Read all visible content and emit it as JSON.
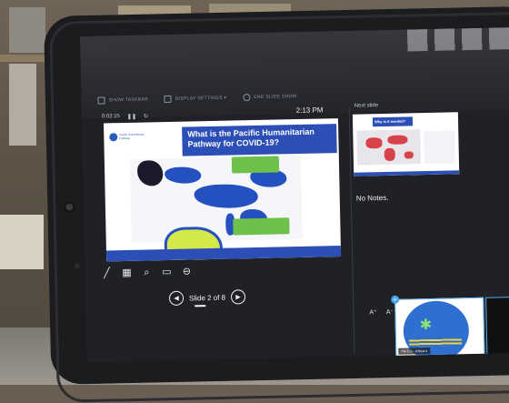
{
  "presenter_view": {
    "toolbar": {
      "show_taskbar": "SHOW TASKBAR",
      "display_settings": "DISPLAY SETTINGS ▾",
      "end_slide_show": "END SLIDE SHOW"
    },
    "elapsed_time": "0:02:15",
    "clock": "2:13 PM",
    "current_slide": {
      "logo_text": "Pacific Humanitarian Pathway",
      "title": "What is the Pacific Humanitarian Pathway for COVID-19?"
    },
    "slide_counter": "Slide 2 of 8",
    "next_slide": {
      "label": "Next slide",
      "title": "Why is it needed?"
    },
    "notes": "No Notes.",
    "thumbnail": {
      "label": "PIFS II - Africa ii"
    }
  },
  "colors": {
    "slide_blue": "#2b4fb6",
    "callout_green": "#6ec04a",
    "australia_yellow": "#d4e84a"
  }
}
